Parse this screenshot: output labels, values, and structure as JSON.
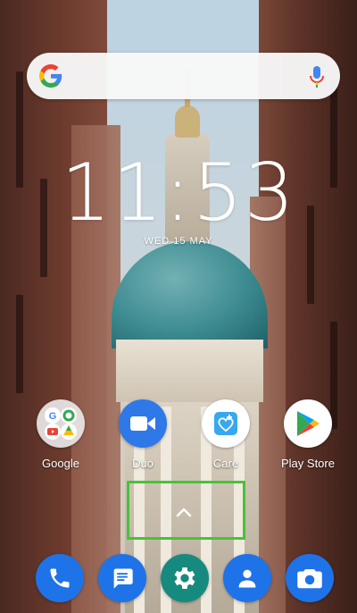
{
  "search": {
    "brand_letter": "G"
  },
  "clock": {
    "time": "11:53",
    "date": "WED 15 MAY"
  },
  "apps": [
    {
      "label": "Google"
    },
    {
      "label": "Duo"
    },
    {
      "label": "Care"
    },
    {
      "label": "Play Store"
    }
  ],
  "colors": {
    "phone_blue": "#1e73e8",
    "settings_teal": "#168a7e",
    "selection_green": "#48c23a",
    "duo_blue": "#2f78e8",
    "care_blue": "#37a8f0"
  },
  "icons": {
    "search_bar": [
      "google-g-icon",
      "microphone-icon"
    ],
    "apps": [
      "google-folder-icon",
      "duo-icon",
      "care-icon",
      "play-store-icon"
    ],
    "drawer": "chevron-up-icon",
    "dock": [
      "phone-icon",
      "messages-icon",
      "settings-icon",
      "contacts-icon",
      "camera-icon"
    ]
  }
}
